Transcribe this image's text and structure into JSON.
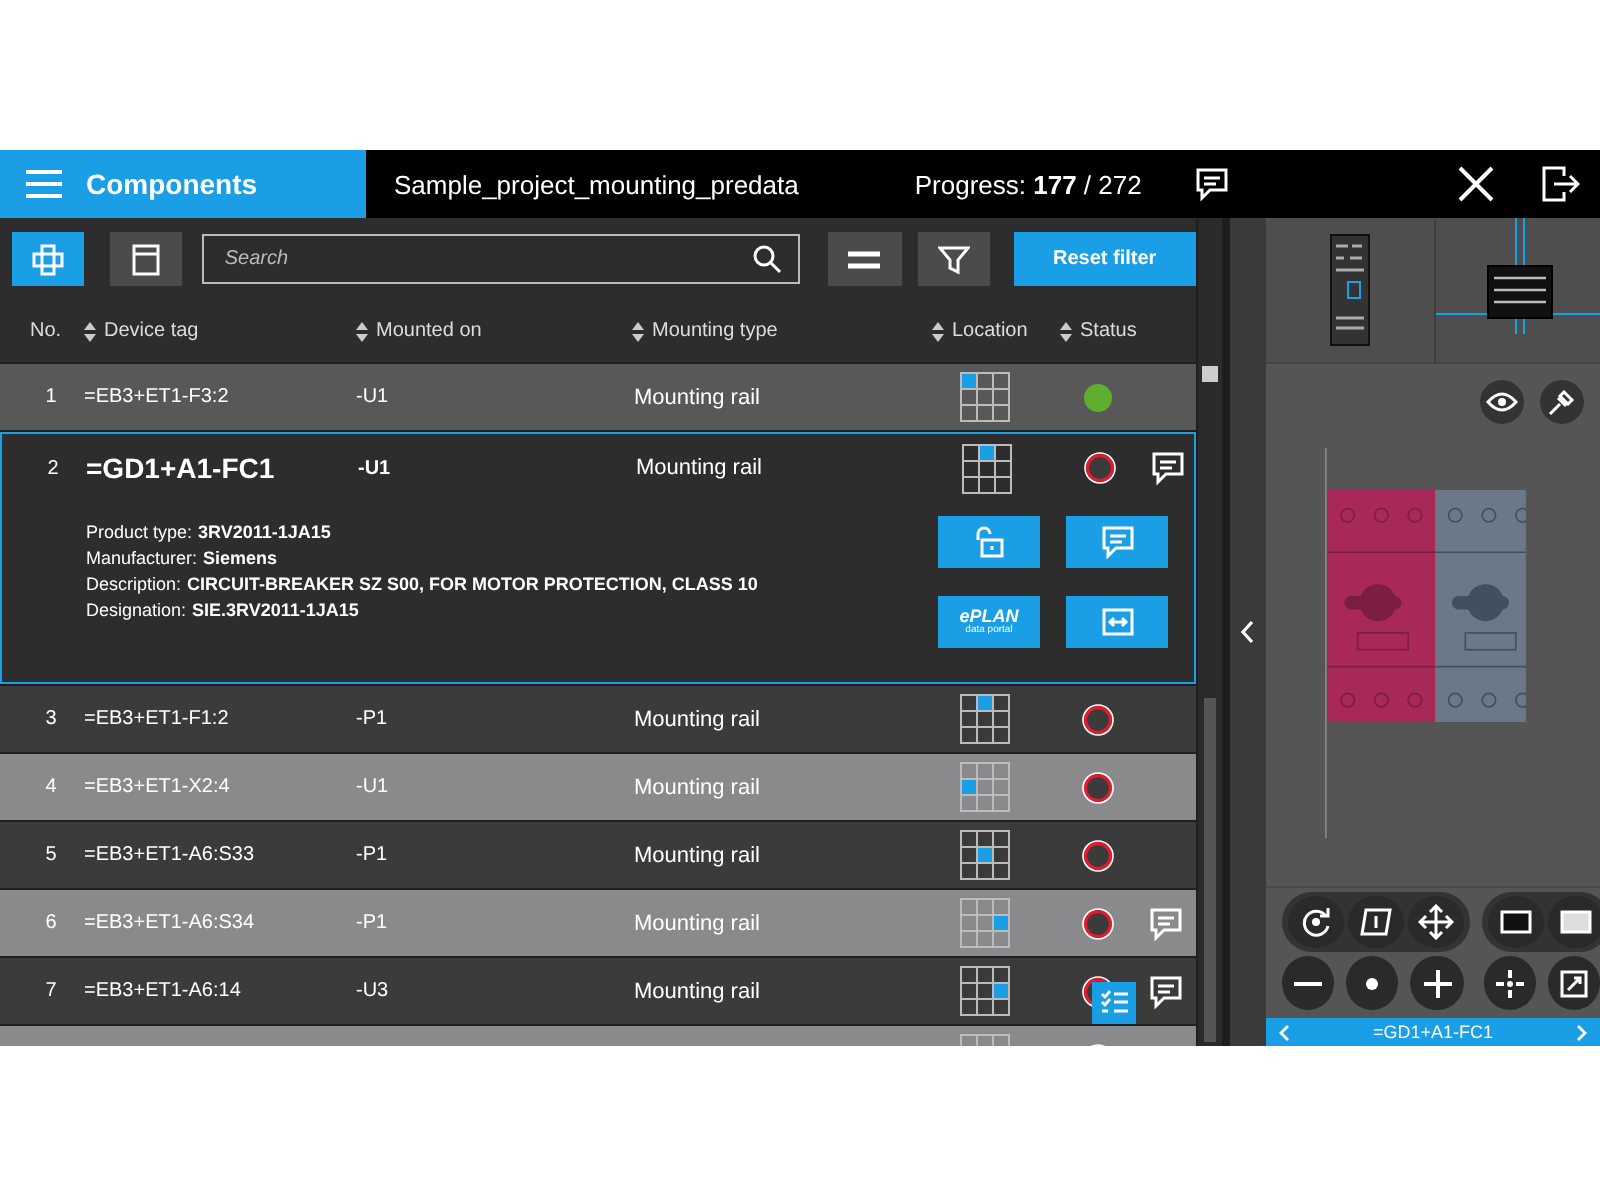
{
  "header": {
    "title": "Components",
    "project": "Sample_project_mounting_predata",
    "progress": "Progress: **177** / 272"
  },
  "toolbar": {
    "view_buttons": [
      {
        "kind": "components",
        "selected": true
      },
      {
        "kind": "cabinet",
        "selected": false
      }
    ],
    "search": {
      "placeholder": "Search"
    },
    "reset_label": "Reset filter"
  },
  "table": {
    "columns": [
      "No.",
      "Device tag",
      "Mounted on",
      "Mounting type",
      "Location",
      "Status"
    ],
    "rows": [
      {
        "no": "1",
        "device_tag": "=EB3+ET1-F3:2",
        "mounted_on": "-U1",
        "mounting_type": "Mounting rail",
        "location": [
          true,
          false,
          false,
          false,
          false,
          false,
          false,
          false,
          false
        ],
        "done": true,
        "comment": false,
        "expanded": false
      },
      {
        "no": "2",
        "device_tag": "=GD1+A1-FC1",
        "mounted_on": "-U1",
        "mounting_type": "Mounting rail",
        "location": [
          false,
          true,
          false,
          false,
          false,
          false,
          false,
          false,
          false
        ],
        "done": false,
        "comment": true,
        "expanded": true,
        "details": [
          {
            "label": "Product type:",
            "value": "3RV2011-1JA15"
          },
          {
            "label": "Manufacturer:",
            "value": "Siemens"
          },
          {
            "label": "Description:",
            "value": "CIRCUIT-BREAKER SZ S00,  FOR MOTOR PROTECTION, CLASS 10"
          },
          {
            "label": "Designation:",
            "value": "SIE.3RV2011-1JA15"
          }
        ],
        "actions": [
          {
            "kind": "unlock"
          },
          {
            "kind": "comment"
          },
          {
            "kind": "eplan",
            "label": "ePLAN",
            "sublabel": "data portal"
          },
          {
            "kind": "exchange"
          }
        ]
      },
      {
        "no": "3",
        "device_tag": "=EB3+ET1-F1:2",
        "mounted_on": "-P1",
        "mounting_type": "Mounting rail",
        "location": [
          false,
          true,
          false,
          false,
          false,
          false,
          false,
          false,
          false
        ],
        "done": false,
        "comment": false,
        "expanded": false
      },
      {
        "no": "4",
        "device_tag": "=EB3+ET1-X2:4",
        "mounted_on": "-U1",
        "mounting_type": "Mounting rail",
        "location": [
          false,
          false,
          false,
          true,
          false,
          false,
          false,
          false,
          false
        ],
        "done": false,
        "comment": false,
        "expanded": false
      },
      {
        "no": "5",
        "device_tag": "=EB3+ET1-A6:S33",
        "mounted_on": "-P1",
        "mounting_type": "Mounting rail",
        "location": [
          false,
          false,
          false,
          false,
          true,
          false,
          false,
          false,
          false
        ],
        "done": false,
        "comment": false,
        "expanded": false
      },
      {
        "no": "6",
        "device_tag": "=EB3+ET1-A6:S34",
        "mounted_on": "-P1",
        "mounting_type": "Mounting rail",
        "location": [
          false,
          false,
          false,
          false,
          false,
          true,
          false,
          false,
          false
        ],
        "done": false,
        "comment": true,
        "expanded": false
      },
      {
        "no": "7",
        "device_tag": "=EB3+ET1-A6:14",
        "mounted_on": "-U3",
        "mounting_type": "Mounting rail",
        "location": [
          false,
          false,
          false,
          false,
          false,
          true,
          false,
          false,
          false
        ],
        "done": false,
        "comment": true,
        "expanded": false,
        "checklist_popup": true
      },
      {
        "done": false
      }
    ]
  },
  "preview": {
    "caption": "=GD1+A1-FC1"
  }
}
